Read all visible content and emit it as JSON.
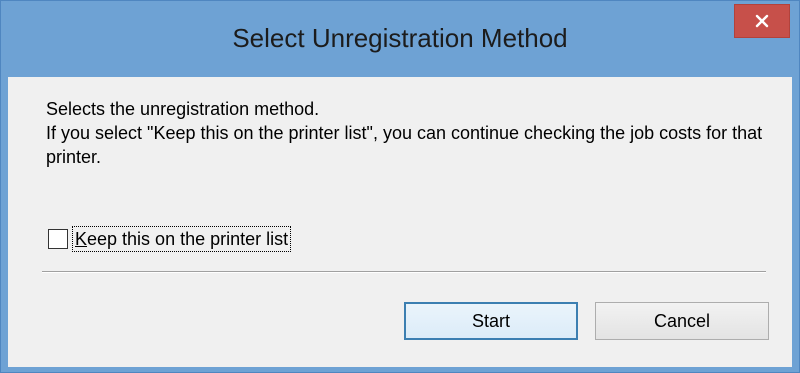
{
  "window": {
    "title": "Select Unregistration Method",
    "close_icon": "close-icon"
  },
  "body": {
    "line1": "Selects the unregistration method.",
    "line2": "If you select \"Keep this on the printer list\", you can continue checking the job costs for that printer."
  },
  "checkbox": {
    "label": "Keep this on the printer list",
    "checked": false
  },
  "buttons": {
    "start_label": "Start",
    "cancel_label": "Cancel"
  },
  "colors": {
    "frame": "#6ea2d4",
    "close_button": "#c7504a",
    "client_background": "#f0f0f0",
    "default_button_border": "#3c7fb1"
  }
}
